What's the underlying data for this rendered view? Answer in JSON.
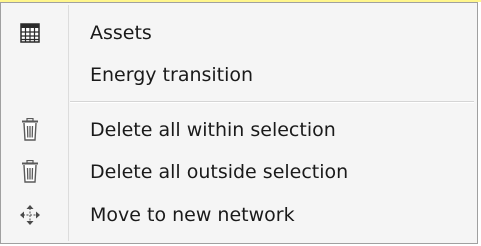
{
  "context_menu": {
    "items": [
      {
        "label": "Assets",
        "icon": "grid-table-icon"
      },
      {
        "label": "Energy transition",
        "icon": ""
      },
      {
        "label": "Delete all within selection",
        "icon": "trash-icon"
      },
      {
        "label": "Delete all outside selection",
        "icon": "trash-icon"
      },
      {
        "label": "Move to new network",
        "icon": "move-arrows-icon"
      }
    ]
  },
  "colors": {
    "menu_background": "#f5f5f5",
    "menu_border": "#a0a0a0",
    "top_strip": "#fff68c",
    "text": "#1a1a1a",
    "separator": "#d5d5d5"
  }
}
